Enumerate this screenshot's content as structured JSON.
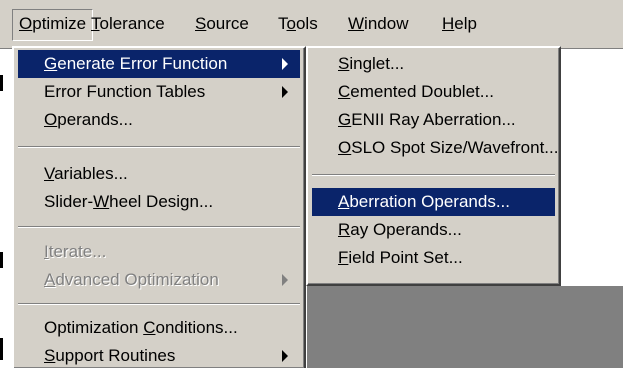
{
  "menubar": [
    {
      "label_u": "O",
      "label_rest": "ptimize",
      "active": true
    },
    {
      "label_u": "T",
      "label_rest": "olerance"
    },
    {
      "label_u": "S",
      "label_rest": "ource"
    },
    {
      "label_pre": "T",
      "label_u": "o",
      "label_rest": "ols"
    },
    {
      "label_u": "W",
      "label_rest": "indow"
    },
    {
      "label_u": "H",
      "label_rest": "elp"
    }
  ],
  "optimize_menu": {
    "generate_error_function": {
      "u": "G",
      "rest": "enerate Error Function"
    },
    "error_function_tables": {
      "text": "Error Function Tables"
    },
    "operands": {
      "u": "O",
      "rest": "perands..."
    },
    "variables": {
      "u": "V",
      "rest": "ariables..."
    },
    "slider_wheel": {
      "pre": "Slider-",
      "u": "W",
      "rest": "heel Design..."
    },
    "iterate": {
      "u": "I",
      "rest": "terate..."
    },
    "advanced_optimization": {
      "u": "A",
      "rest": "dvanced Optimization"
    },
    "optimization_conditions": {
      "pre": "Optimization ",
      "u": "C",
      "rest": "onditions..."
    },
    "support_routines": {
      "u": "S",
      "rest": "upport Routines"
    }
  },
  "generate_submenu": {
    "singlet": {
      "u": "S",
      "rest": "inglet..."
    },
    "cemented_doublet": {
      "u": "C",
      "rest": "emented Doublet..."
    },
    "genii": {
      "u": "G",
      "rest": "ENII Ray Aberration..."
    },
    "oslo": {
      "u": "O",
      "rest": "SLO Spot Size/Wavefront..."
    },
    "aberration_operands": {
      "u": "A",
      "rest": "berration Operands..."
    },
    "ray_operands": {
      "u": "R",
      "rest": "ay Operands..."
    },
    "field_point_set": {
      "u": "F",
      "rest": "ield Point Set..."
    }
  },
  "colors": {
    "menu_face": "#d4d0c8",
    "highlight": "#0a246a",
    "highlight_text": "#ffffff",
    "disabled_text": "#808080",
    "workspace": "#808080"
  }
}
